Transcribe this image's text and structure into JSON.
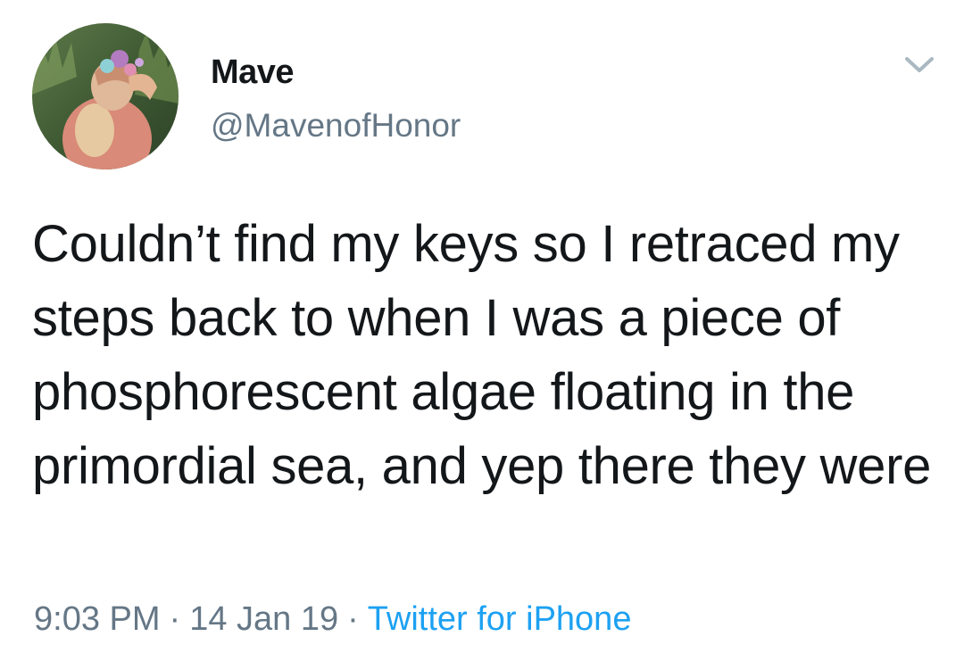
{
  "tweet": {
    "author": {
      "name": "Mave",
      "handle": "@MavenofHonor",
      "avatar_icon": "profile-photo"
    },
    "menu_icon": "chevron-down-icon",
    "text": "Couldn’t find my keys so I retraced my steps back to when I was a piece of phosphorescent algae floating in the primordial sea, and yep there they were",
    "time": "9:03 PM",
    "separator": "·",
    "date": "14 Jan 19",
    "source": "Twitter for iPhone",
    "colors": {
      "text": "#14171a",
      "secondary": "#657786",
      "link": "#1da1f2"
    }
  }
}
